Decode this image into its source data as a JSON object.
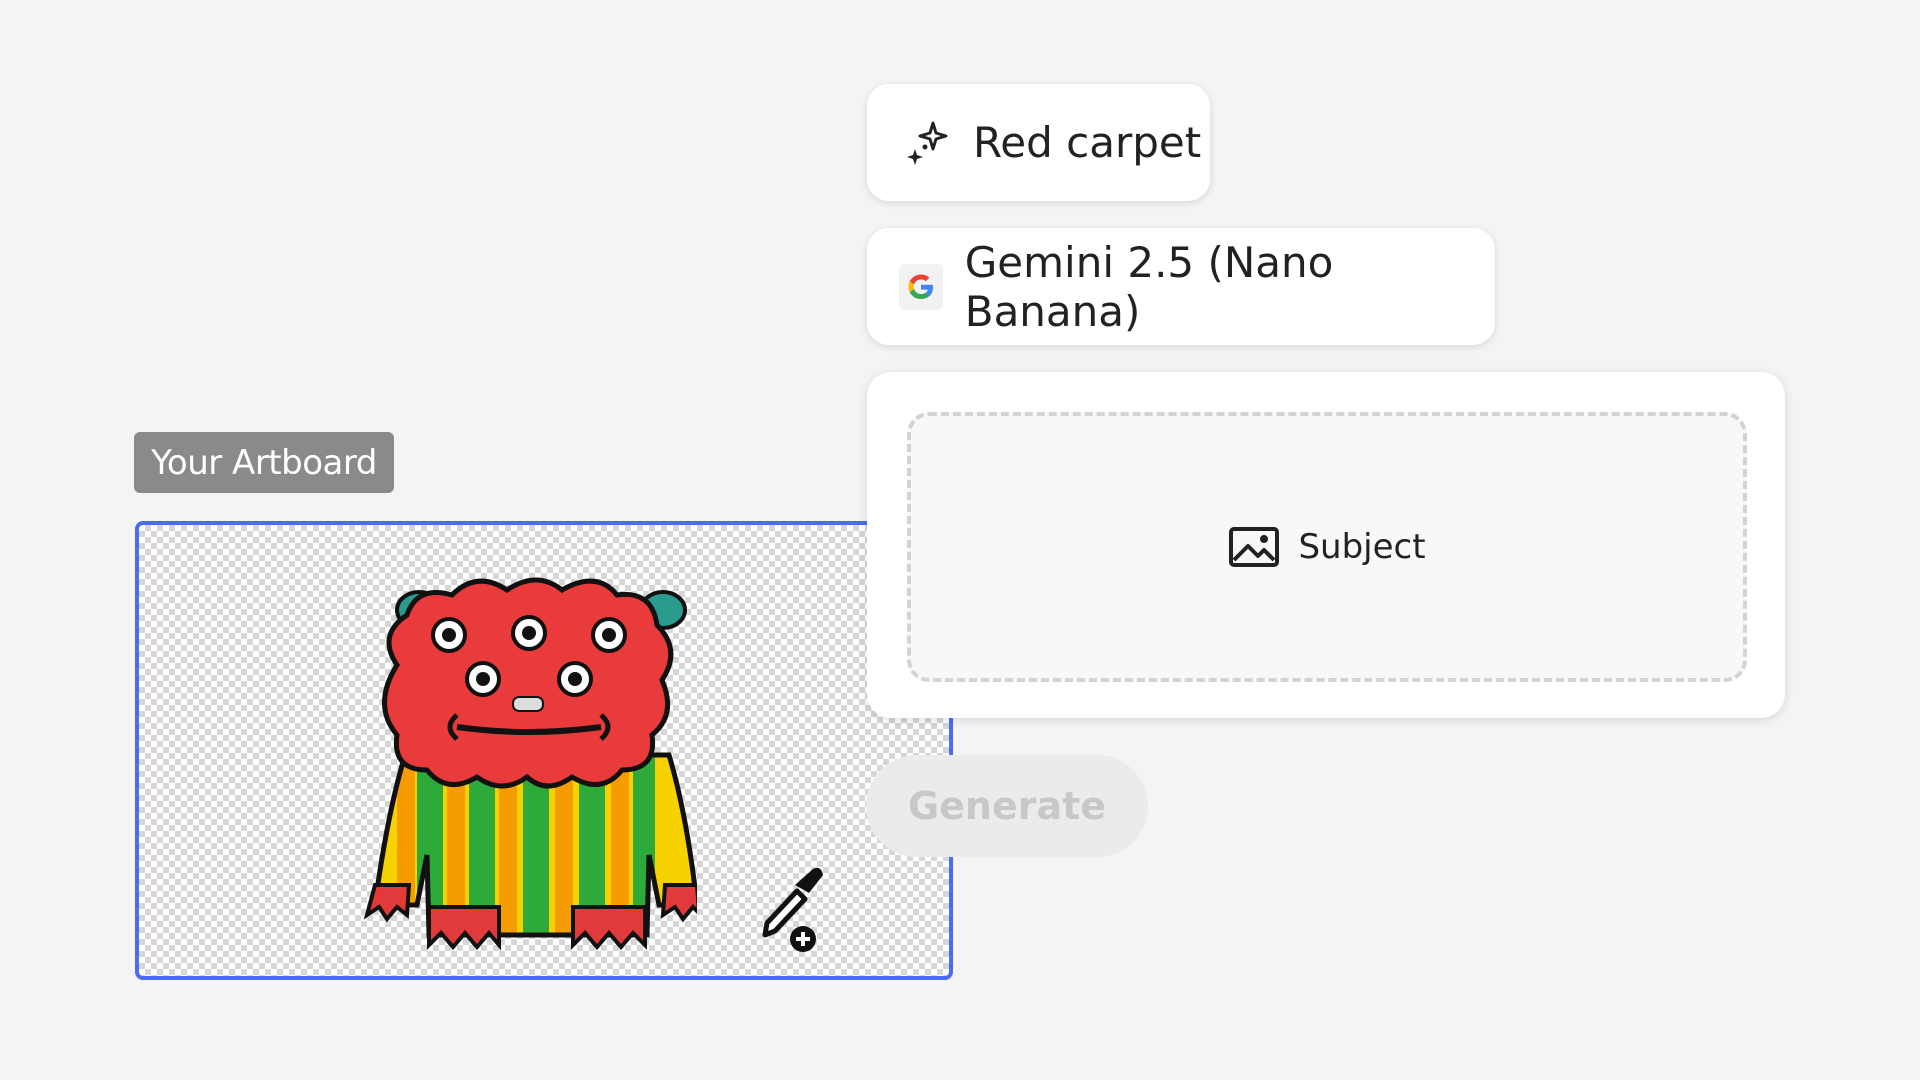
{
  "artboard": {
    "label": "Your Artboard"
  },
  "style_chip": {
    "label": "Red carpet",
    "icon": "sparkle-icon"
  },
  "model_chip": {
    "label": "Gemini 2.5 (Nano Banana)",
    "icon": "google-g-icon"
  },
  "subject_panel": {
    "label": "Subject",
    "icon": "image-icon"
  },
  "generate_button": {
    "label": "Generate",
    "state": "disabled"
  },
  "colors": {
    "background": "#f4f4f4",
    "artboard_border": "#4a6cf0",
    "label_bg": "#8a8a8a",
    "generate_bg": "#ebebeb",
    "generate_text": "#c8c8c8"
  }
}
